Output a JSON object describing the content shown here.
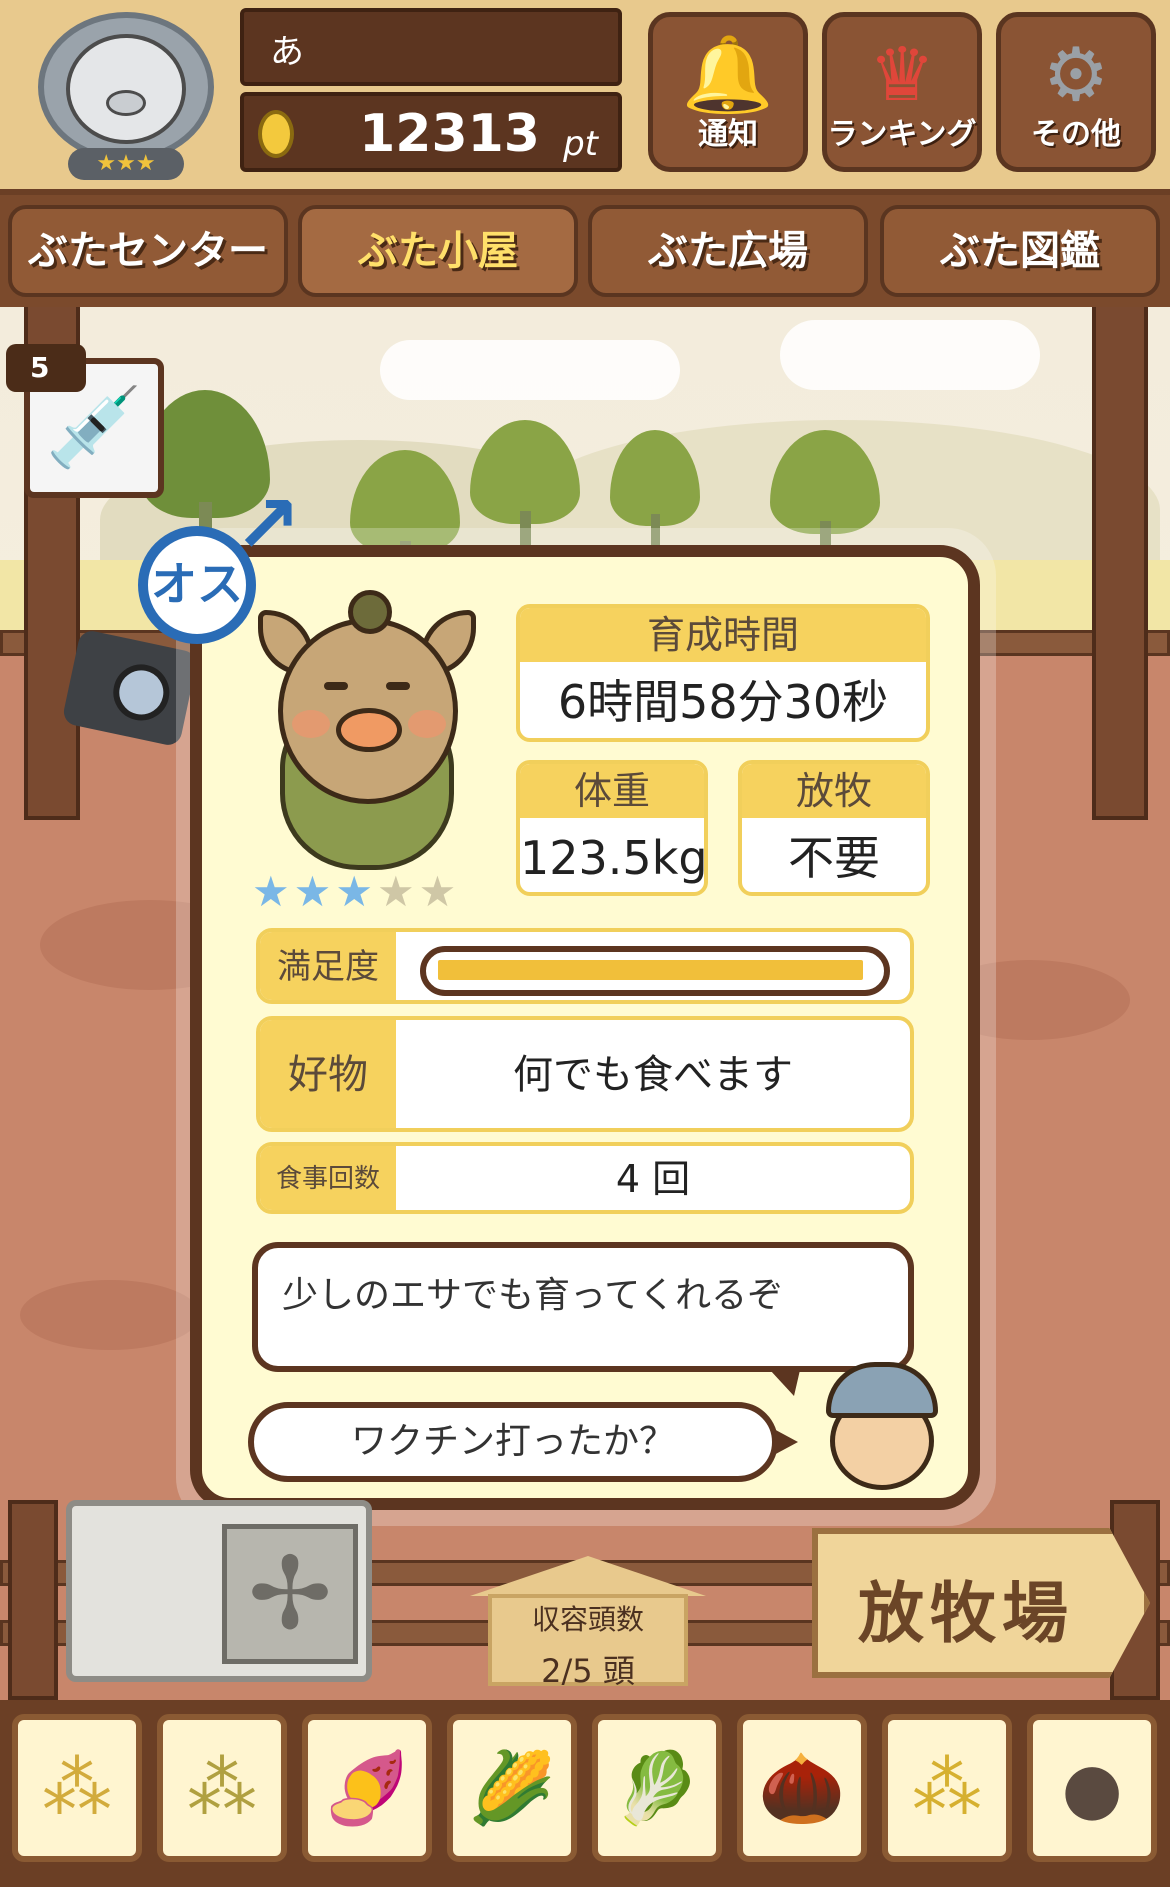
{
  "header": {
    "player_name": "あ",
    "points": "12313",
    "points_unit": "pt",
    "avatar_stars": "★★★",
    "buttons": [
      {
        "label": "通知",
        "icon": "bell-icon",
        "glyph": "🔔"
      },
      {
        "label": "ランキング",
        "icon": "crown-icon",
        "glyph": "♛"
      },
      {
        "label": "その他",
        "icon": "gear-icon",
        "glyph": "⚙"
      }
    ]
  },
  "tabs": [
    {
      "label": "ぶたセンター",
      "active": false
    },
    {
      "label": "ぶた小屋",
      "active": true
    },
    {
      "label": "ぶた広場",
      "active": false
    },
    {
      "label": "ぶた図鑑",
      "active": false
    }
  ],
  "item": {
    "syringe_count": "5",
    "syringe_icon": "syringe-icon"
  },
  "pig_card": {
    "gender": "オス",
    "rating": 3,
    "rating_max": 5,
    "growth_time_label": "育成時間",
    "growth_time": "6時間58分30秒",
    "weight_label": "体重",
    "weight": "123.5kg",
    "release_label": "放牧",
    "release": "不要",
    "satisfaction_label": "満足度",
    "satisfaction": 0.98,
    "favorite_label": "好物",
    "favorite": "何でも食べます",
    "meals_label": "食事回数",
    "meals": "4 回",
    "message": "少しのエサでも育ってくれるぞ",
    "hint": "ワクチン打ったか？"
  },
  "bottom": {
    "capacity_label": "収容頭数",
    "capacity_value": "2/5 頭",
    "pasture_label": "放牧場"
  },
  "feeds": [
    {
      "icon": "grain-icon",
      "glyph": "⁂"
    },
    {
      "icon": "mixed-grain-icon",
      "glyph": "⁂"
    },
    {
      "icon": "sweet-potato-icon",
      "glyph": "🍠"
    },
    {
      "icon": "corn-icon",
      "glyph": "🌽"
    },
    {
      "icon": "vegetables-icon",
      "glyph": "🥬"
    },
    {
      "icon": "acorn-icon",
      "glyph": "🌰"
    },
    {
      "icon": "bowl-feed-icon",
      "glyph": "⁂"
    },
    {
      "icon": "plate-feed-icon",
      "glyph": "●"
    }
  ]
}
